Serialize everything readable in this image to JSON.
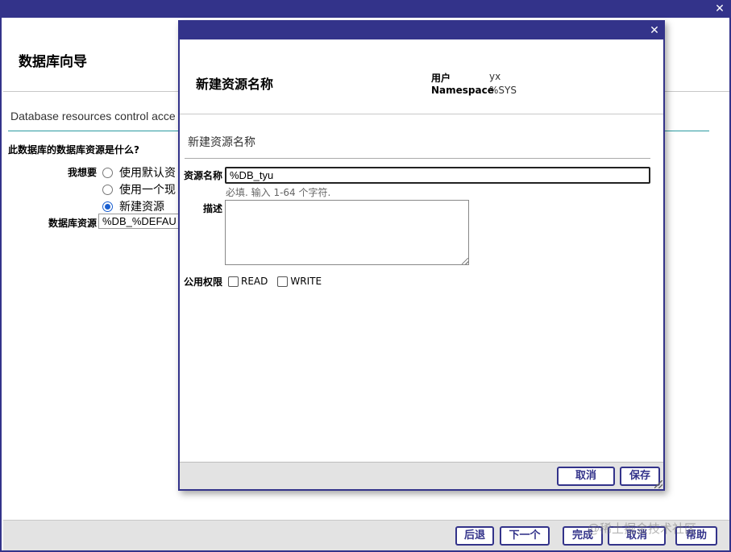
{
  "wizard": {
    "title": "数据库向导",
    "subtitle": "Database resources control acce",
    "question": "此数据库的数据库资源是什么?",
    "want_label": "我想要",
    "options": [
      {
        "label": "使用默认资",
        "selected": false
      },
      {
        "label": "使用一个现",
        "selected": false
      },
      {
        "label": "新建资源",
        "selected": true
      }
    ],
    "db_resource_label": "数据库资源",
    "db_resource_value": "%DB_%DEFAU",
    "buttons": {
      "back": "后退",
      "next": "下一个",
      "finish": "完成",
      "cancel": "取消",
      "help": "帮助"
    },
    "close_glyph": "✕"
  },
  "dialog": {
    "title": "新建资源名称",
    "close_glyph": "✕",
    "meta": {
      "user_label": "用户",
      "user_value": "yx",
      "namespace_label": "Namespace",
      "namespace_value": "%SYS"
    },
    "section_title": "新建资源名称",
    "fields": {
      "name_label": "资源名称",
      "name_value": "%DB_tyu",
      "name_hint": "必填. 输入 1-64 个字符.",
      "description_label": "描述",
      "description_value": "",
      "public_permission_label": "公用权限",
      "permissions": [
        {
          "label": "READ",
          "checked": false
        },
        {
          "label": "WRITE",
          "checked": false
        }
      ]
    },
    "buttons": {
      "cancel": "取消",
      "save": "保存"
    }
  },
  "watermark": "@稀土掘金技术社区",
  "colors": {
    "title_bar": "#33338a",
    "accent_rule": "#2a9aa0",
    "footer_bg": "#e3e3e3",
    "radio_selected": "#1a5fd0"
  }
}
